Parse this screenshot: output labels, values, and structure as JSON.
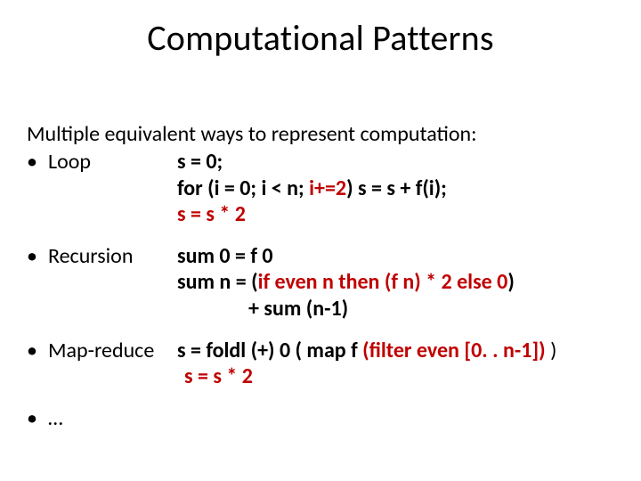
{
  "title": "Computational Patterns",
  "intro": "Multiple equivalent ways to represent computation:",
  "labels": {
    "loop": "Loop",
    "recursion": "Recursion",
    "mapreduce": "Map-reduce",
    "ellipsis": "…"
  },
  "code": {
    "loop": {
      "l1a": "s = 0;",
      "l2a": "for (i = 0; i < n; ",
      "l2b": "i+=2",
      "l2c": ")  s = s + f(i);",
      "l3a": "s = s * 2"
    },
    "recursion": {
      "l1a": "sum 0 = f 0",
      "l2a": "sum n = (",
      "l2b": "if even n then (f n) * 2 else 0",
      "l2c": ")",
      "l3a": "+ sum (n-1)"
    },
    "mapreduce": {
      "l1a": "s = foldl (+) 0 ( map f ",
      "l1b": "(filter even [0. . n-1])",
      "l1c": " )",
      "l2a": "s = s * 2"
    }
  }
}
